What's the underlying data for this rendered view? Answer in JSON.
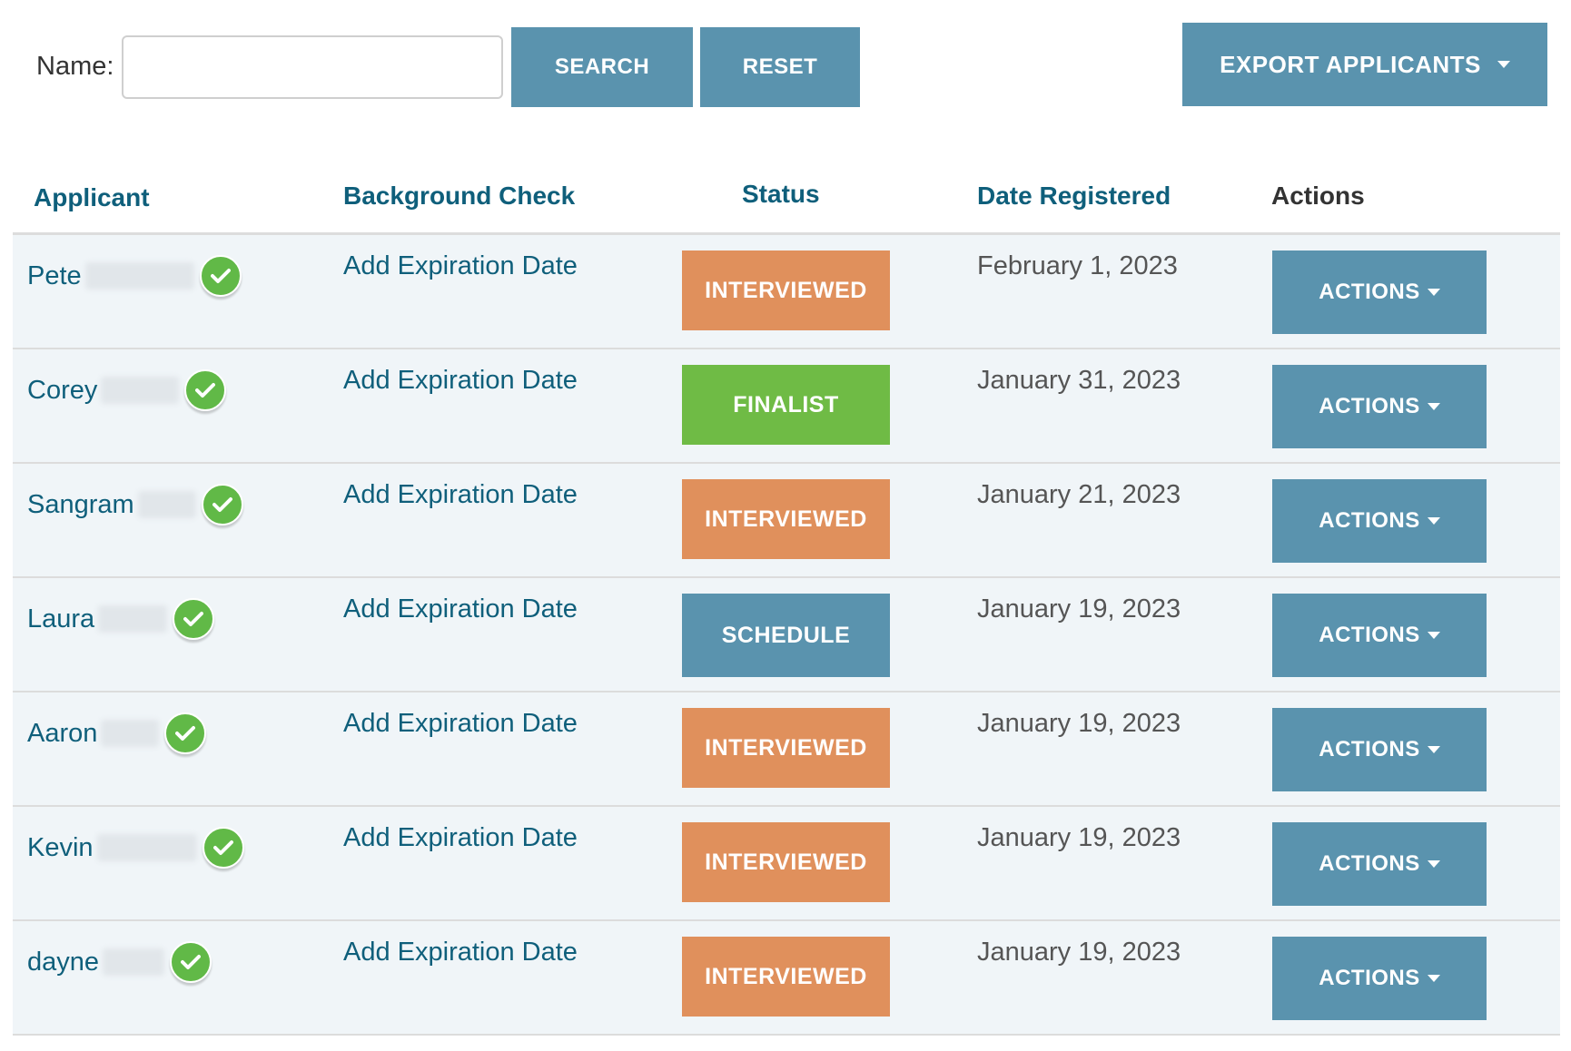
{
  "search": {
    "label": "Name:",
    "value": "",
    "placeholder": "",
    "search_button": "SEARCH",
    "reset_button": "RESET"
  },
  "export_button": "EXPORT APPLICANTS",
  "table": {
    "headers": {
      "applicant": "Applicant",
      "background_check": "Background Check",
      "status": "Status",
      "date_registered": "Date Registered",
      "actions": "Actions"
    },
    "rows": [
      {
        "name": "Pete",
        "background": "Add Expiration Date",
        "status": "INTERVIEWED",
        "status_type": "interviewed",
        "date": "February 1, 2023",
        "action": "ACTIONS"
      },
      {
        "name": "Corey",
        "background": "Add Expiration Date",
        "status": "FINALIST",
        "status_type": "finalist",
        "date": "January 31, 2023",
        "action": "ACTIONS"
      },
      {
        "name": "Sangram",
        "background": "Add Expiration Date",
        "status": "INTERVIEWED",
        "status_type": "interviewed",
        "date": "January 21, 2023",
        "action": "ACTIONS"
      },
      {
        "name": "Laura",
        "background": "Add Expiration Date",
        "status": "SCHEDULE",
        "status_type": "schedule",
        "date": "January 19, 2023",
        "action": "ACTIONS"
      },
      {
        "name": "Aaron",
        "background": "Add Expiration Date",
        "status": "INTERVIEWED",
        "status_type": "interviewed",
        "date": "January 19, 2023",
        "action": "ACTIONS"
      },
      {
        "name": "Kevin",
        "background": "Add Expiration Date",
        "status": "INTERVIEWED",
        "status_type": "interviewed",
        "date": "January 19, 2023",
        "action": "ACTIONS"
      },
      {
        "name": "dayne",
        "background": "Add Expiration Date",
        "status": "INTERVIEWED",
        "status_type": "interviewed",
        "date": "January 19, 2023",
        "action": "ACTIONS"
      }
    ]
  },
  "colors": {
    "primary_button": "#5a93ae",
    "interviewed": "#e0905c",
    "finalist": "#6fbb45",
    "verified_check": "#61b947",
    "link_text": "#0f5f7b",
    "row_background": "#f0f5f8"
  },
  "icons": {
    "verified": "check-circle-icon",
    "dropdown": "caret-down-icon"
  }
}
